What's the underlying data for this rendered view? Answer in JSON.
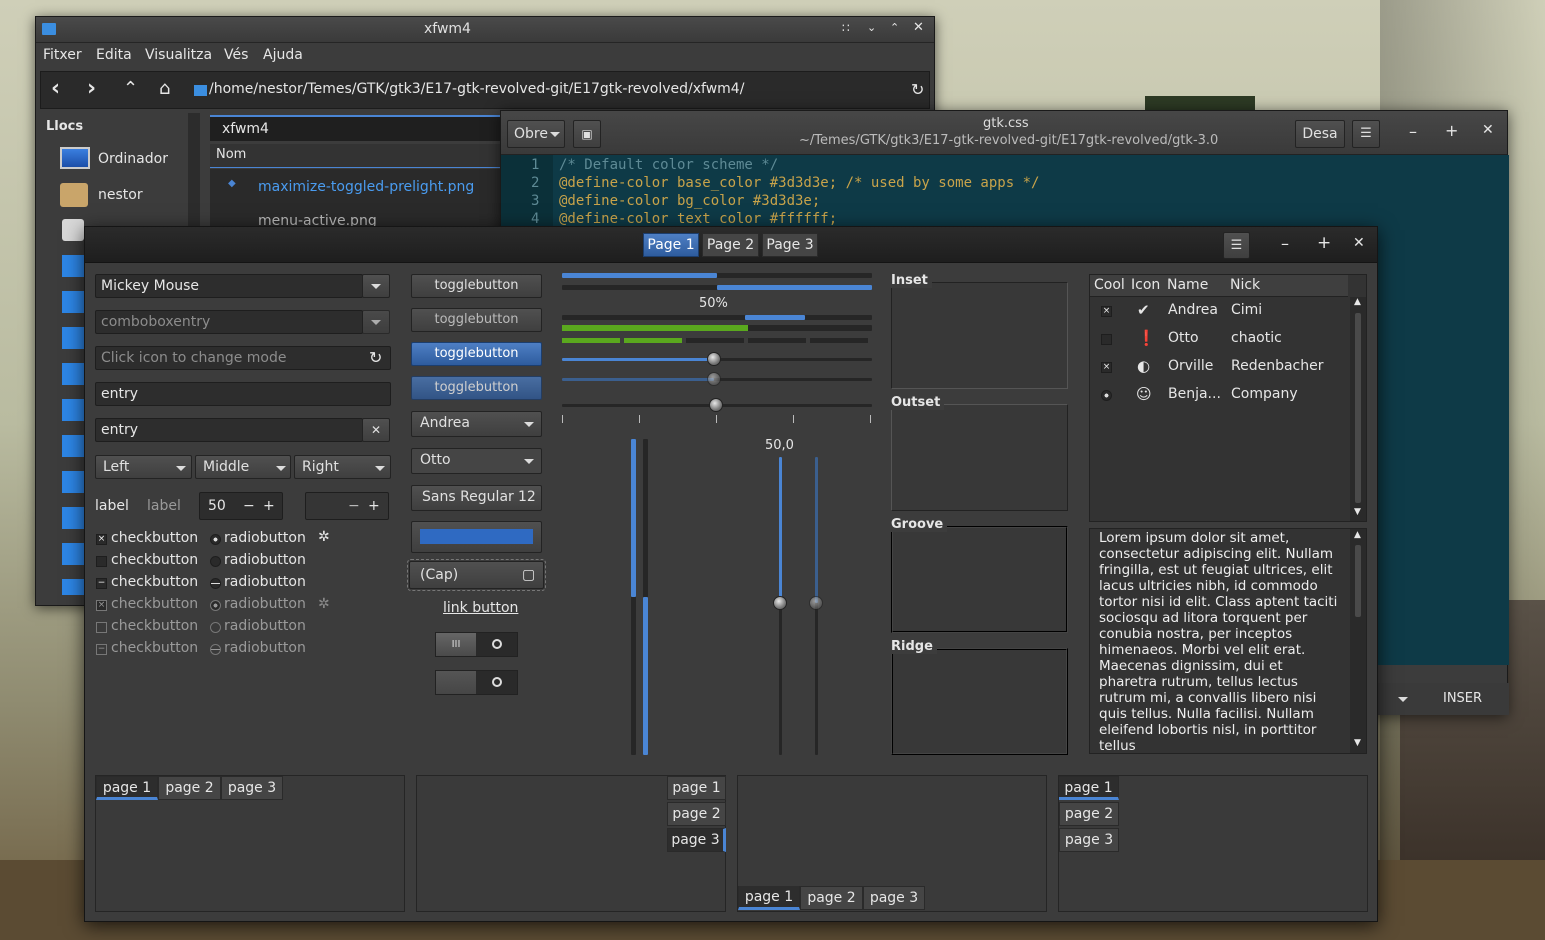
{
  "file_manager": {
    "title": "xfwm4",
    "menu": [
      "Fitxer",
      "Edita",
      "Visualitza",
      "Vés",
      "Ajuda"
    ],
    "path": "/home/nestor/Temes/GTK/gtk3/E17-gtk-revolved-git/E17gtk-revolved/xfwm4/",
    "places_header": "Llocs",
    "places": [
      "Ordinador",
      "nestor"
    ],
    "tab": "xfwm4",
    "column_header": "Nom",
    "files": [
      "maximize-toggled-prelight.png",
      "menu-active.png"
    ]
  },
  "editor": {
    "title": "gtk.css",
    "subtitle": "~/Temes/GTK/gtk3/E17-gtk-revolved-git/E17gtk-revolved/gtk-3.0",
    "open_label": "Obre",
    "save_label": "Desa",
    "insert_mode": "INSER",
    "lines": [
      {
        "n": "1",
        "code": "/* Default color scheme */"
      },
      {
        "n": "2",
        "code": "@define-color base_color #3d3d3e; /* used by some apps */"
      },
      {
        "n": "3",
        "code": "@define-color bg_color #3d3d3e;"
      },
      {
        "n": "4",
        "code": "@define-color text_color #ffffff;"
      }
    ]
  },
  "demo": {
    "stack_tabs": [
      "Page 1",
      "Page 2",
      "Page 3"
    ],
    "combo1": "Mickey Mouse",
    "combo2": "comboboxentry",
    "entry_placeholder": "Click icon to change mode",
    "entry1": "entry",
    "entry2": "entry",
    "align_buttons": [
      "Left",
      "Middle",
      "Right"
    ],
    "label1": "label",
    "label2": "label",
    "spin_value": "50",
    "checkbutton": "checkbutton",
    "radiobutton": "radiobutton",
    "toggles": [
      "togglebutton",
      "togglebutton",
      "togglebutton",
      "togglebutton"
    ],
    "combo_andrea": "Andrea",
    "combo_otto": "Otto",
    "font_name": "Sans Regular",
    "font_size": "12",
    "file_chooser": "(Cap)",
    "link_button": "link button",
    "progress_text": "50%",
    "scale_value": "50,0",
    "progress_fraction": 0.5,
    "level_fraction": 0.6,
    "frames": [
      "Inset",
      "Outset",
      "Groove",
      "Ridge"
    ],
    "tree_headers": [
      "Cool",
      "Icon",
      "Name",
      "Nick"
    ],
    "tree_rows": [
      {
        "name": "Andrea",
        "nick": "Cimi"
      },
      {
        "name": "Otto",
        "nick": "chaotic"
      },
      {
        "name": "Orville",
        "nick": "Redenbacher"
      },
      {
        "name": "Benja...",
        "nick": "Company"
      }
    ],
    "lorem": "Lorem ipsum dolor sit amet, consectetur adipiscing elit. Nullam fringilla, est ut feugiat ultrices, elit lacus ultricies nibh, id commodo tortor nisi id elit. Class aptent taciti sociosqu ad litora torquent per conubia nostra, per inceptos himenaeos. Morbi vel elit erat. Maecenas dignissim, dui et pharetra rutrum, tellus lectus rutrum mi, a convallis libero nisi quis tellus. Nulla facilisi. Nullam eleifend lobortis nisl, in porttitor tellus",
    "notebook_tabs": [
      "page 1",
      "page 2",
      "page 3"
    ]
  },
  "colors": {
    "accent": "#4a85d4",
    "bg": "#3c3c3c",
    "code_bg": "#0e3a47",
    "green": "#5aa81e"
  }
}
